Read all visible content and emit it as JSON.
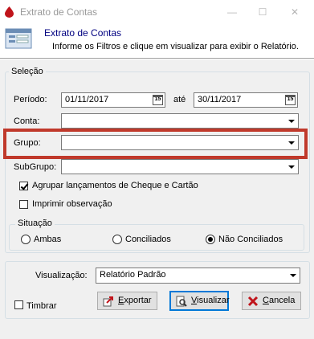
{
  "window": {
    "title": "Extrato de Contas"
  },
  "header": {
    "title": "Extrato de Contas",
    "subtitle": "Informe os Filtros e clique em visualizar para exibir o Relatório."
  },
  "selecao": {
    "group_label": "Seleção",
    "periodo_label": "Período:",
    "periodo_inicio": "01/11/2017",
    "ate_label": "até",
    "periodo_fim": "30/11/2017",
    "calendar_day": "15",
    "conta_label": "Conta:",
    "conta_value": "",
    "grupo_label": "Grupo:",
    "grupo_value": "",
    "subgrupo_label": "SubGrupo:",
    "subgrupo_value": "",
    "agrupar_label": "Agrupar lançamentos de Cheque e Cartão",
    "agrupar_checked": true,
    "imprimir_label": "Imprimir observação",
    "imprimir_checked": false,
    "situacao": {
      "group_label": "Situação",
      "options": [
        "Ambas",
        "Conciliados",
        "Não Conciliados"
      ],
      "selected": "Não Conciliados"
    }
  },
  "footer": {
    "visualizacao_label": "Visualização:",
    "visualizacao_value": "Relatório Padrão",
    "timbrar_label": "Timbrar",
    "timbrar_checked": false,
    "exportar_label": "xportar",
    "exportar_accel": "E",
    "visualizar_label": "isualizar",
    "visualizar_accel": "V",
    "cancelar_label": "ancela",
    "cancelar_accel": "C"
  },
  "colors": {
    "header_title": "#000080",
    "highlight": "#c0392b",
    "default_button_border": "#0078d7"
  }
}
